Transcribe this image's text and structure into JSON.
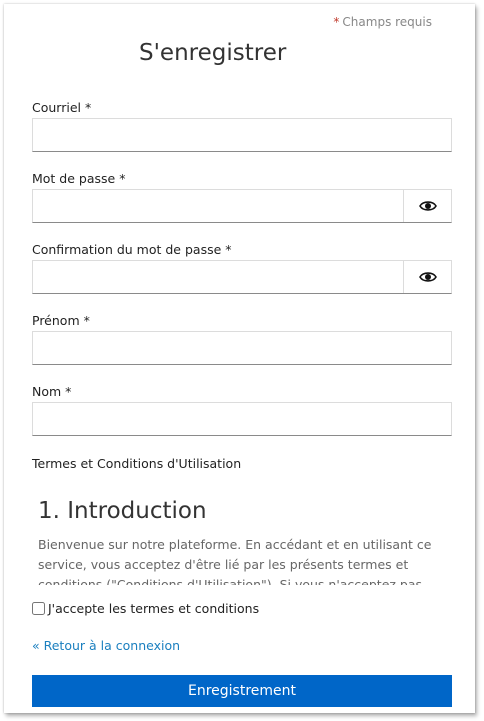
{
  "header": {
    "required_star": "*",
    "required_note": "Champs requis",
    "title": "S'enregistrer"
  },
  "fields": {
    "email": {
      "label": "Courriel *",
      "value": "",
      "placeholder": ""
    },
    "password": {
      "label": "Mot de passe *",
      "value": "",
      "placeholder": "",
      "toggle_icon": "eye-icon"
    },
    "password_confirm": {
      "label": "Confirmation du mot de passe *",
      "value": "",
      "placeholder": "",
      "toggle_icon": "eye-icon"
    },
    "first_name": {
      "label": "Prénom *",
      "value": "",
      "placeholder": ""
    },
    "last_name": {
      "label": "Nom *",
      "value": "",
      "placeholder": ""
    }
  },
  "terms": {
    "label": "Termes et Conditions d'Utilisation",
    "heading": "1. Introduction",
    "text": "Bienvenue sur notre plateforme. En accédant et en utilisant ce service, vous acceptez d'être lié par les présents termes et conditions (\"Conditions d'Utilisation\"). Si vous n'acceptez pas ces conditions, veuillez ne pas utiliser ce service.",
    "accept_label": "J'accepte les termes et conditions",
    "accepted": false
  },
  "footer": {
    "back_link": "« Retour à la connexion",
    "submit_label": "Enregistrement"
  },
  "colors": {
    "accent": "#0066c8",
    "link": "#1a7fbf",
    "required": "#c0392b"
  }
}
